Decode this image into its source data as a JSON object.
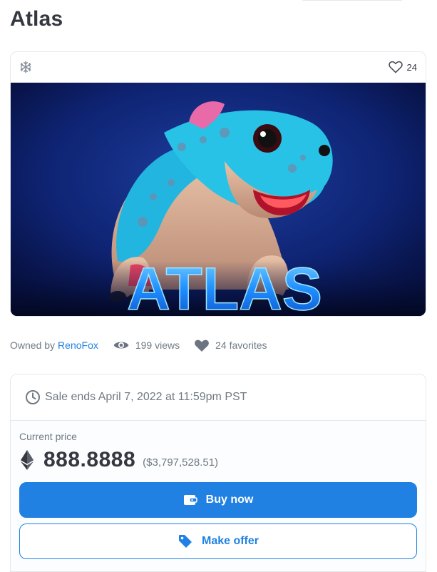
{
  "title": "Atlas",
  "card": {
    "chain_icon": "ethereum-snowflake-icon",
    "favorite_icon": "heart-outline-icon",
    "favorite_count": "24",
    "artwork_text": "ATLAS"
  },
  "meta": {
    "owned_by_label": "Owned by",
    "owner": "RenoFox",
    "views": "199 views",
    "favorites": "24 favorites"
  },
  "sale": {
    "clock_icon": "clock-icon",
    "ends_text": "Sale ends April 7, 2022 at 11:59pm PST",
    "current_price_label": "Current price",
    "currency_icon": "ethereum-icon",
    "price": "888.8888",
    "price_usd": "($3,797,528.51)",
    "buy_label": "Buy now",
    "offer_label": "Make offer"
  },
  "colors": {
    "accent": "#2081e2",
    "text": "#353840",
    "muted": "#707a83",
    "border": "#e5e8eb"
  }
}
